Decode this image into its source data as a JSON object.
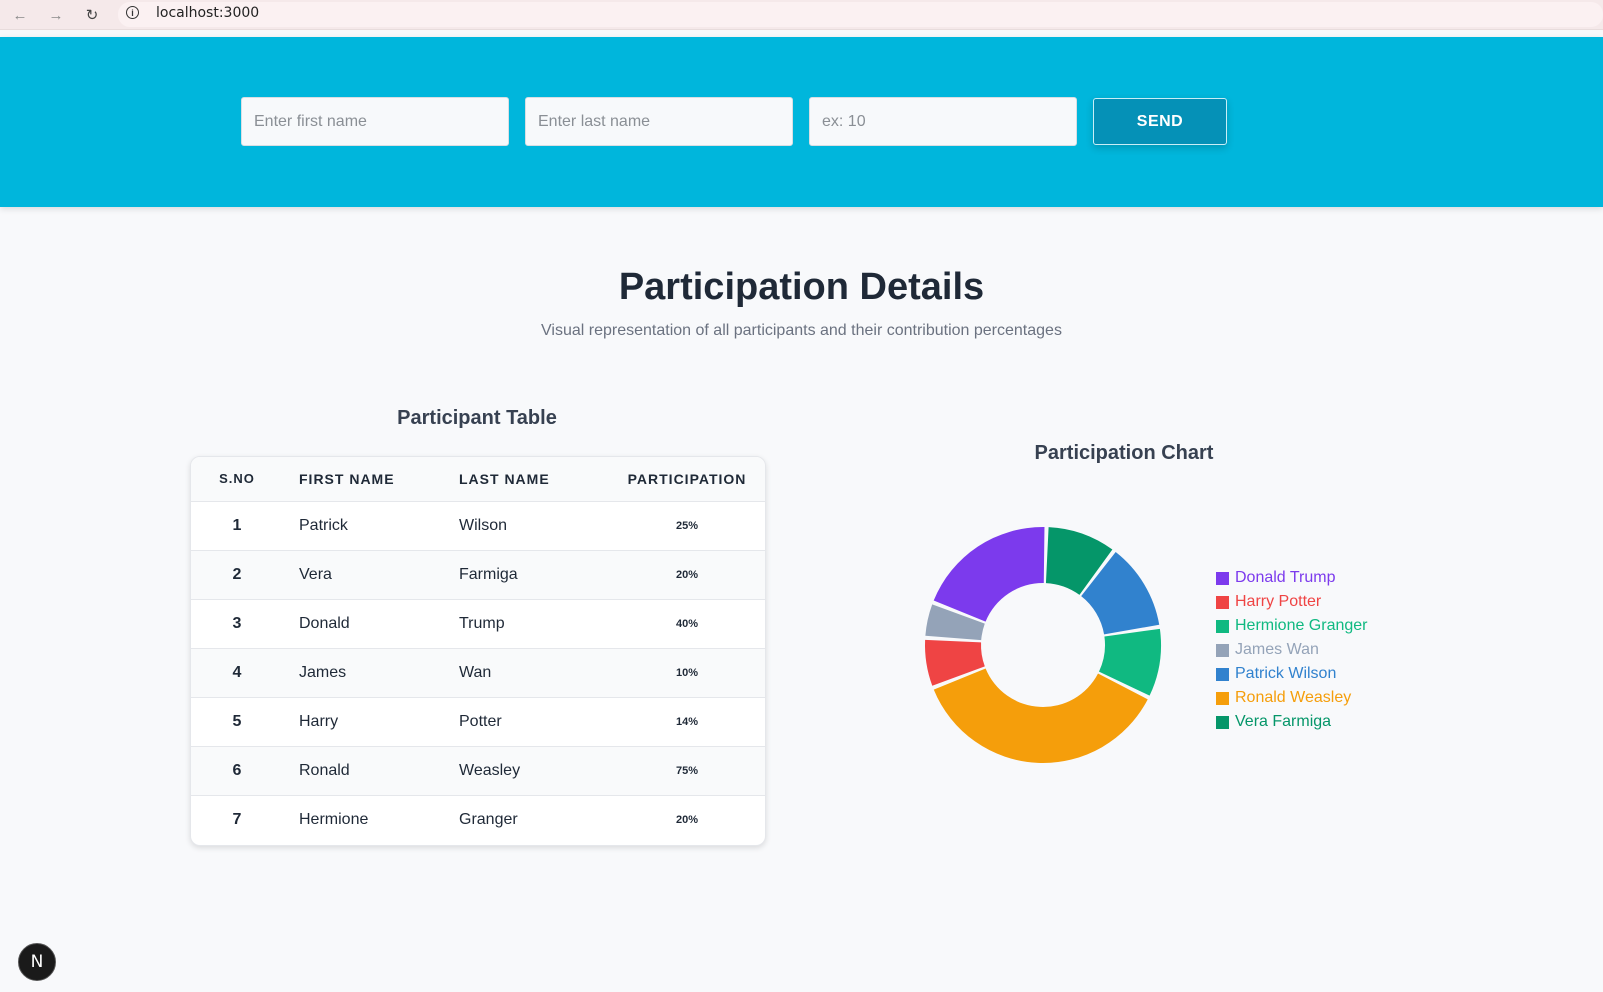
{
  "browser": {
    "url": "localhost:3000"
  },
  "form": {
    "first_name_placeholder": "Enter first name",
    "last_name_placeholder": "Enter last name",
    "participation_placeholder": "ex: 10",
    "send_label": "SEND"
  },
  "page": {
    "title": "Participation Details",
    "subtitle": "Visual representation of all participants and their contribution percentages"
  },
  "table": {
    "title": "Participant Table",
    "headers": {
      "sno": "S.NO",
      "first": "FIRST NAME",
      "last": "LAST NAME",
      "participation": "PARTICIPATION"
    },
    "rows": [
      {
        "sno": "1",
        "first": "Patrick",
        "last": "Wilson",
        "participation": "25%"
      },
      {
        "sno": "2",
        "first": "Vera",
        "last": "Farmiga",
        "participation": "20%"
      },
      {
        "sno": "3",
        "first": "Donald",
        "last": "Trump",
        "participation": "40%"
      },
      {
        "sno": "4",
        "first": "James",
        "last": "Wan",
        "participation": "10%"
      },
      {
        "sno": "5",
        "first": "Harry",
        "last": "Potter",
        "participation": "14%"
      },
      {
        "sno": "6",
        "first": "Ronald",
        "last": "Weasley",
        "participation": "75%"
      },
      {
        "sno": "7",
        "first": "Hermione",
        "last": "Granger",
        "participation": "20%"
      }
    ]
  },
  "chart": {
    "title": "Participation Chart"
  },
  "chart_data": {
    "type": "pie",
    "title": "Participation Chart",
    "categories": [
      "Donald Trump",
      "Harry Potter",
      "Hermione Granger",
      "James Wan",
      "Patrick Wilson",
      "Ronald Weasley",
      "Vera Farmiga"
    ],
    "values": [
      40,
      14,
      20,
      10,
      25,
      75,
      20
    ],
    "colors": [
      "#7c3aed",
      "#ef4444",
      "#10b981",
      "#94a3b8",
      "#3182ce",
      "#f59e0b",
      "#059669"
    ],
    "slice_order": [
      "Vera Farmiga",
      "Patrick Wilson",
      "Hermione Granger",
      "Ronald Weasley",
      "Harry Potter",
      "James Wan",
      "Donald Trump"
    ],
    "donut": true,
    "legend": "right"
  }
}
